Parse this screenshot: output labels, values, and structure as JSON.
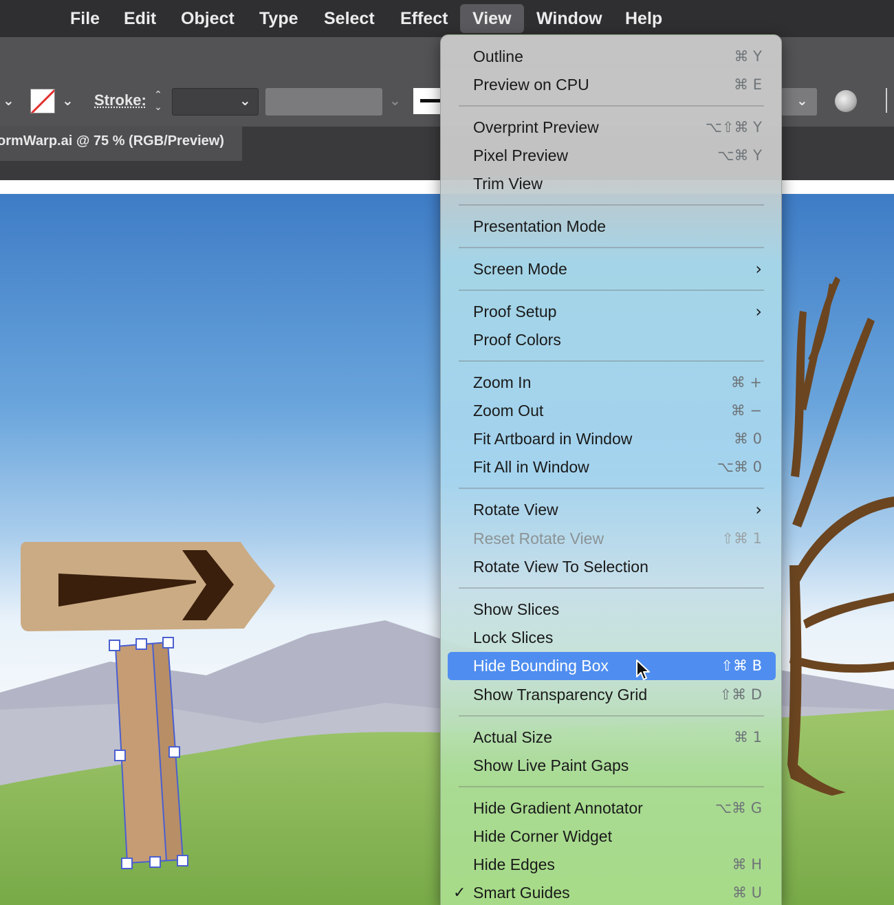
{
  "menubar": {
    "items": [
      {
        "label": "File"
      },
      {
        "label": "Edit"
      },
      {
        "label": "Object"
      },
      {
        "label": "Type"
      },
      {
        "label": "Select"
      },
      {
        "label": "Effect"
      },
      {
        "label": "View"
      },
      {
        "label": "Window"
      },
      {
        "label": "Help"
      }
    ],
    "active": "View"
  },
  "controlbar": {
    "stroke_label": "Stroke:",
    "fill_swatch": "none",
    "icons": [
      "chevron-down-icon",
      "stepper-icon",
      "color-globe-icon"
    ]
  },
  "document_tab": {
    "title": "ormWarp.ai @ 75 % (RGB/Preview)"
  },
  "view_menu": {
    "items": [
      {
        "label": "Outline",
        "shortcut": "⌘ Y"
      },
      {
        "label": "Preview on CPU",
        "shortcut": "⌘ E"
      },
      {
        "label": "Overprint Preview",
        "shortcut": "⌥⇧⌘ Y"
      },
      {
        "label": "Pixel Preview",
        "shortcut": "⌥⌘ Y"
      },
      {
        "label": "Trim View",
        "shortcut": ""
      },
      {
        "label": "Presentation Mode",
        "shortcut": ""
      },
      {
        "label": "Screen Mode",
        "shortcut": "",
        "submenu": "›"
      },
      {
        "label": "Proof Setup",
        "shortcut": "",
        "submenu": "›"
      },
      {
        "label": "Proof Colors",
        "shortcut": ""
      },
      {
        "label": "Zoom In",
        "shortcut": "⌘ +"
      },
      {
        "label": "Zoom Out",
        "shortcut": "⌘ −"
      },
      {
        "label": "Fit Artboard in Window",
        "shortcut": "⌘ 0"
      },
      {
        "label": "Fit All in Window",
        "shortcut": "⌥⌘ 0"
      },
      {
        "label": "Rotate View",
        "shortcut": "",
        "submenu": "›"
      },
      {
        "label": "Reset Rotate View",
        "shortcut": "⇧⌘ 1",
        "disabled": true
      },
      {
        "label": "Rotate View To Selection",
        "shortcut": ""
      },
      {
        "label": "Show Slices",
        "shortcut": ""
      },
      {
        "label": "Lock Slices",
        "shortcut": ""
      },
      {
        "label": "Hide Bounding Box",
        "shortcut": "⇧⌘ B",
        "highlighted": true
      },
      {
        "label": "Show Transparency Grid",
        "shortcut": "⇧⌘ D"
      },
      {
        "label": "Actual Size",
        "shortcut": "⌘ 1"
      },
      {
        "label": "Show Live Paint Gaps",
        "shortcut": ""
      },
      {
        "label": "Hide Gradient Annotator",
        "shortcut": "⌥⌘ G"
      },
      {
        "label": "Hide Corner Widget",
        "shortcut": ""
      },
      {
        "label": "Hide Edges",
        "shortcut": "⌘ H"
      },
      {
        "label": "Smart Guides",
        "shortcut": "⌘ U",
        "checked": true,
        "check_mark": "✓"
      }
    ]
  },
  "colors": {
    "menubar_bg": "#2f2f31",
    "controlbar_bg": "#535355",
    "highlight": "#4f8ef0",
    "sign_wood": "#cbab84",
    "arrow": "#3a1f0c",
    "tree": "#6b4520",
    "selection": "#4a5fd0"
  }
}
